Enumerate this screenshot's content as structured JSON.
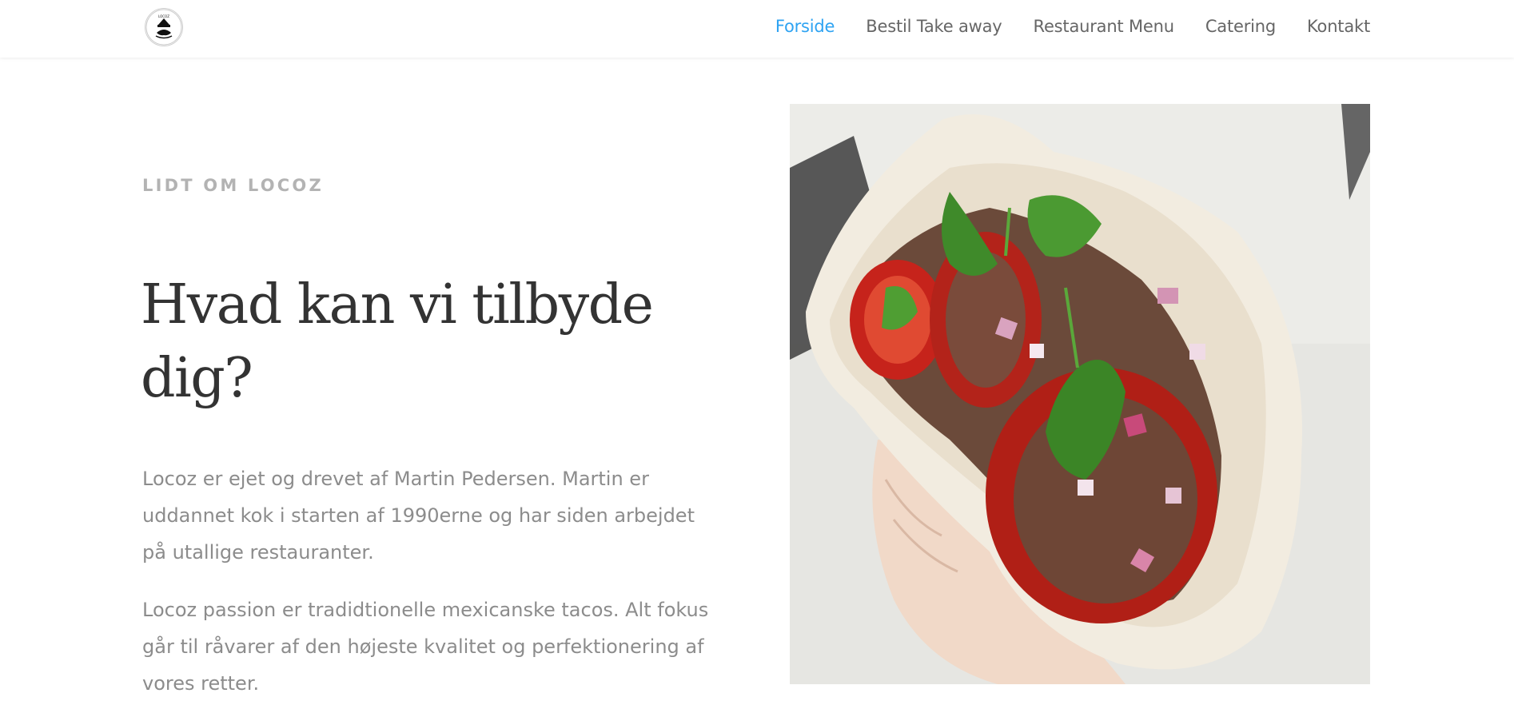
{
  "header": {
    "logo_text": "LOCOZ",
    "nav": [
      {
        "label": "Forside",
        "active": true
      },
      {
        "label": "Bestil Take away",
        "active": false
      },
      {
        "label": "Restaurant Menu",
        "active": false
      },
      {
        "label": "Catering",
        "active": false
      },
      {
        "label": "Kontakt",
        "active": false
      }
    ]
  },
  "about": {
    "eyebrow": "LIDT OM LOCOZ",
    "heading": "Hvad kan vi tilbyde dig?",
    "paragraphs": [
      "Locoz er ejet og drevet af Martin Pedersen. Martin er uddannet kok i starten af 1990erne og har siden arbejdet på utallige restauranter.",
      "Locoz passion er tradidtionelle mexicanske tacos. Alt fokus går til råvarer af den højeste kvalitet og perfektionering af vores retter."
    ]
  },
  "colors": {
    "accent": "#2ea3f2",
    "nav_text": "#666666",
    "heading": "#333333",
    "body_text": "#8c8c8c",
    "eyebrow": "#b3b3b3"
  }
}
